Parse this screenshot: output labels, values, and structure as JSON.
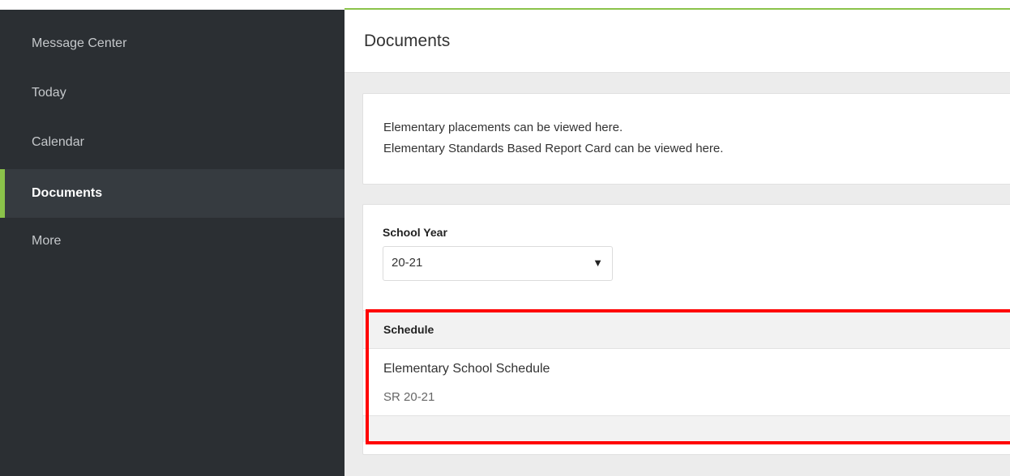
{
  "sidebar": {
    "items": [
      {
        "label": "Message Center",
        "active": false
      },
      {
        "label": "Today",
        "active": false
      },
      {
        "label": "Calendar",
        "active": false
      },
      {
        "label": "Documents",
        "active": true
      },
      {
        "label": "More",
        "active": false
      }
    ]
  },
  "header": {
    "title": "Documents"
  },
  "info_card": {
    "line1": "Elementary placements can be viewed here.",
    "line2": "Elementary Standards Based Report Card can be viewed here."
  },
  "documents_card": {
    "school_year_label": "School Year",
    "school_year_value": "20-21",
    "schedule_heading": "Schedule",
    "schedule_item_name": "Elementary School Schedule",
    "schedule_item_sub": "SR 20-21"
  },
  "colors": {
    "sidebar_bg": "#2b2f33",
    "accent_green": "#8bc34a",
    "highlight_red": "#ff0000"
  }
}
